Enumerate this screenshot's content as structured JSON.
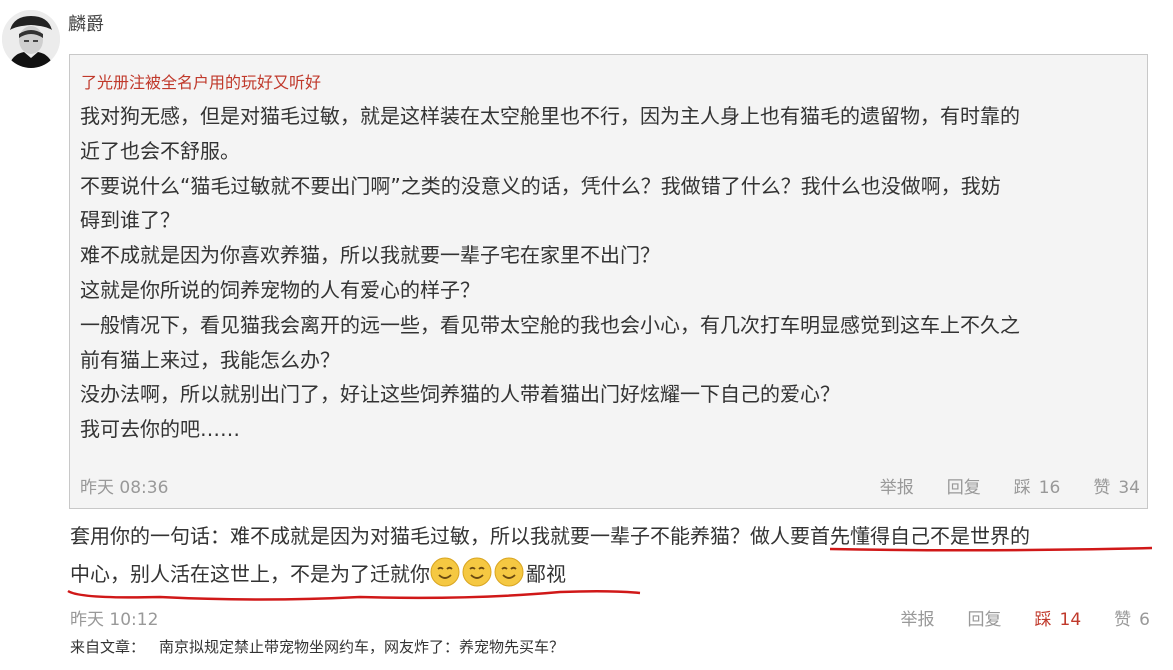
{
  "comment": {
    "username": "麟爵",
    "quoted": {
      "username": "了光册注被全名户用的玩好又听好",
      "lines": [
        "我对狗无感，但是对猫毛过敏，就是这样装在太空舱里也不行，因为主人身上也有猫毛的遗留物，有时靠的",
        "近了也会不舒服。",
        "不要说什么“猫毛过敏就不要出门啊”之类的没意义的话，凭什么？我做错了什么？我什么也没做啊，我妨",
        "碍到谁了？",
        "难不成就是因为你喜欢养猫，所以我就要一辈子宅在家里不出门？",
        "这就是你所说的饲养宠物的人有爱心的样子？",
        "一般情况下，看见猫我会离开的远一些，看见带太空舱的我也会小心，有几次打车明显感觉到这车上不久之",
        "前有猫上来过，我能怎么办？",
        "没办法啊，所以就别出门了，好让这些饲养猫的人带着猫出门好炫耀一下自己的爱心？",
        "我可去你的吧……"
      ],
      "time": "昨天 08:36",
      "actions": {
        "report": "举报",
        "reply": "回复",
        "downvote": "踩",
        "downvote_count": "16",
        "upvote": "赞",
        "upvote_count": "34"
      }
    },
    "reply": {
      "line1": "套用你的一句话：难不成就是因为对猫毛过敏，所以我就要一辈子不能养猫？做人要首先懂得自己不是世界的",
      "line2_text": "中心，别人活在这世上，不是为了迁就你",
      "line2_suffix": "鄙视"
    },
    "time": "昨天 10:12",
    "actions": {
      "report": "举报",
      "reply": "回复",
      "downvote": "踩",
      "downvote_count": "14",
      "upvote": "赞",
      "upvote_count": "6"
    },
    "source": {
      "label": "来自文章：",
      "title": "南京拟规定禁止带宠物坐网约车，网友炸了：养宠物先买车？"
    }
  },
  "colors": {
    "quote_user": "#c0392b",
    "active_downvote": "#c0392b",
    "annotation_underline": "#d01818",
    "emoji": "#f5c842"
  },
  "icons": [
    "avatar-portrait",
    "smile-emoji-icon"
  ]
}
